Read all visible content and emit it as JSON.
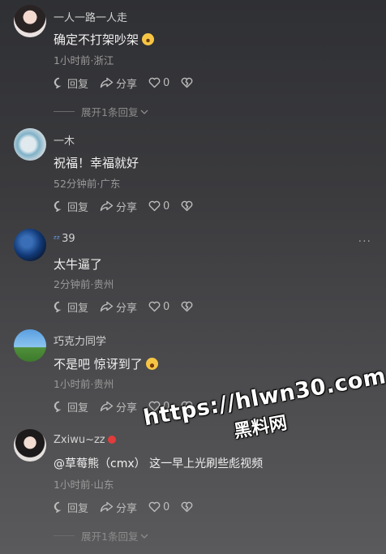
{
  "comments": [
    {
      "username": "一人一路一人走",
      "text": "确定不打架吵架",
      "meta": "1小时前·浙江",
      "reply_label": "回复",
      "share_label": "分享",
      "likes": "0",
      "expand": "展开1条回复"
    },
    {
      "username": "一木",
      "text": "祝福！幸福就好",
      "meta": "52分钟前·广东",
      "reply_label": "回复",
      "share_label": "分享",
      "likes": "0"
    },
    {
      "username": "39",
      "text": "太牛逼了",
      "meta": "2分钟前·贵州",
      "reply_label": "回复",
      "share_label": "分享",
      "likes": "0",
      "more": "···"
    },
    {
      "username": "巧克力同学",
      "text": "不是吧 惊讶到了",
      "meta": "1小时前·贵州",
      "reply_label": "回复",
      "share_label": "分享",
      "likes": "0"
    },
    {
      "username": "Zxiwu~zz",
      "text": "@草莓熊（cmx）  这一早上光刷些彪视频",
      "meta": "1小时前·山东",
      "reply_label": "回复",
      "share_label": "分享",
      "likes": "0",
      "expand": "展开1条回复"
    }
  ],
  "watermark": {
    "line1": "https://hlwn30.com",
    "line2": "黑料网"
  },
  "colors": {
    "text_primary": "#f0f0f0",
    "text_secondary": "#9a9a9a",
    "username": "#d2d2d2"
  },
  "icons": [
    "reply-icon",
    "share-icon",
    "heart-icon",
    "dislike-heart-icon",
    "chevron-down-icon",
    "sleep-emoji-icon",
    "laugh-emoji-icon",
    "more-icon"
  ]
}
